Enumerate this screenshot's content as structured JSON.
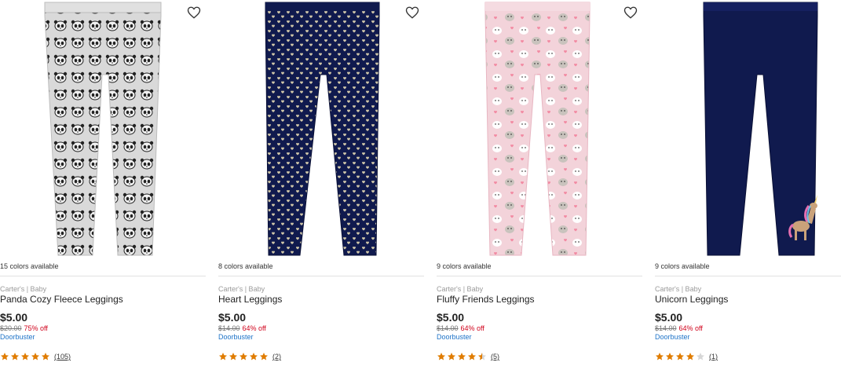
{
  "colors": {
    "star": "#e07c00",
    "star_empty": "#d6d6d6",
    "sale": "#d0021b",
    "link": "#1e73c8",
    "navy": "#101a4e",
    "grey": "#d9d9d9",
    "pink": "#f3d3da"
  },
  "products": [
    {
      "colors_available": "15 colors available",
      "brand": "Carter's | Baby",
      "name": "Panda Cozy Fleece Leggings",
      "price": "$5.00",
      "was": "$20.00",
      "discount": "75% off",
      "promo": "Doorbuster",
      "rating": 5,
      "reviews": "(105)",
      "wishlist_icon": "heart-outline-icon",
      "pattern": "panda"
    },
    {
      "colors_available": "8 colors available",
      "brand": "Carter's | Baby",
      "name": "Heart Leggings",
      "price": "$5.00",
      "was": "$14.00",
      "discount": "64% off",
      "promo": "Doorbuster",
      "rating": 5,
      "reviews": "(2)",
      "wishlist_icon": "heart-outline-icon",
      "pattern": "hearts"
    },
    {
      "colors_available": "9 colors available",
      "brand": "Carter's | Baby",
      "name": "Fluffy Friends Leggings",
      "price": "$5.00",
      "was": "$14.00",
      "discount": "64% off",
      "promo": "Doorbuster",
      "rating": 4.5,
      "reviews": "(5)",
      "wishlist_icon": "heart-outline-icon",
      "pattern": "pets"
    },
    {
      "colors_available": "9 colors available",
      "brand": "Carter's | Baby",
      "name": "Unicorn Leggings",
      "price": "$5.00",
      "was": "$14.00",
      "discount": "64% off",
      "promo": "Doorbuster",
      "rating": 4,
      "reviews": "(1)",
      "wishlist_icon": "heart-outline-icon",
      "pattern": "unicorn"
    }
  ]
}
